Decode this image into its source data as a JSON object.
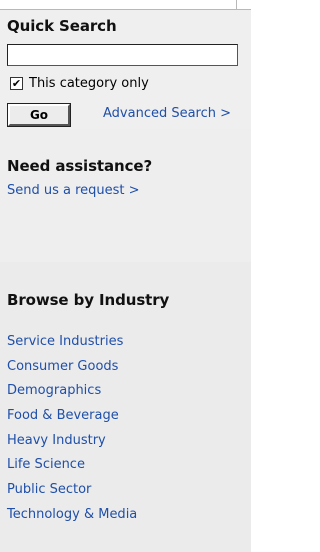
{
  "quick_search": {
    "title": "Quick Search",
    "input_value": "",
    "checkbox_label": "This category only",
    "checkbox_checked": true,
    "go_label": "Go",
    "advanced_link": "Advanced Search >"
  },
  "assistance": {
    "title": "Need assistance?",
    "request_link": "Send us a request >"
  },
  "browse": {
    "title": "Browse by Industry",
    "items": [
      "Service Industries",
      "Consumer Goods",
      "Demographics",
      "Food & Beverage",
      "Heavy Industry",
      "Life Science",
      "Public Sector",
      "Technology & Media"
    ]
  },
  "colors": {
    "link": "#1f4fa8",
    "panel_bg": "#efefef"
  }
}
